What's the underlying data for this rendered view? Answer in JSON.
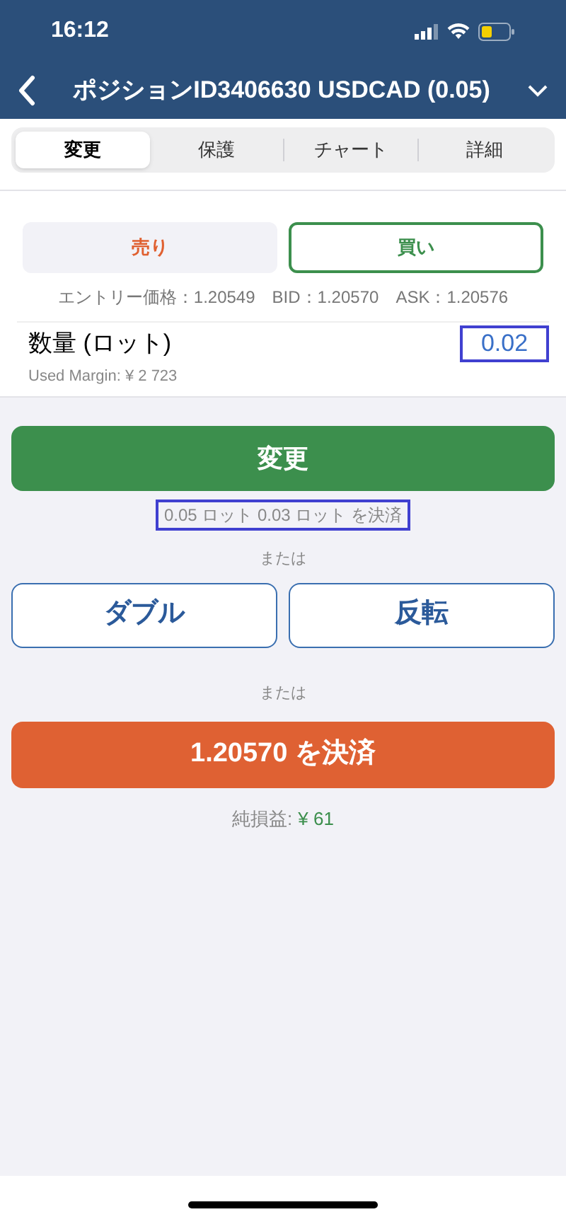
{
  "status_bar": {
    "time": "16:12"
  },
  "header": {
    "title": "ポジションID3406630 USDCAD (0.05)"
  },
  "tabs": [
    {
      "label": "変更",
      "selected": true
    },
    {
      "label": "保護",
      "selected": false
    },
    {
      "label": "チャート",
      "selected": false
    },
    {
      "label": "詳細",
      "selected": false
    }
  ],
  "sides": [
    {
      "label": "売り",
      "kind": "sell",
      "selected": false
    },
    {
      "label": "買い",
      "kind": "buy",
      "selected": true
    }
  ],
  "quotes": [
    "エントリー価格：1.20549",
    "BID：1.20570",
    "ASK：1.20576"
  ],
  "quantity": {
    "label": "数量 (ロット)",
    "value": "0.02",
    "margin": "Used Margin: ¥ 2 723"
  },
  "modify_button": "変更",
  "close_note": "0.05 ロット 0.03 ロット を決済",
  "or_1": "または",
  "alt_buttons": [
    "ダブル",
    "反転"
  ],
  "or_2": "または",
  "close_button": "1.20570 を決済",
  "pnl": {
    "label": "純損益:",
    "value": "¥ 61"
  }
}
